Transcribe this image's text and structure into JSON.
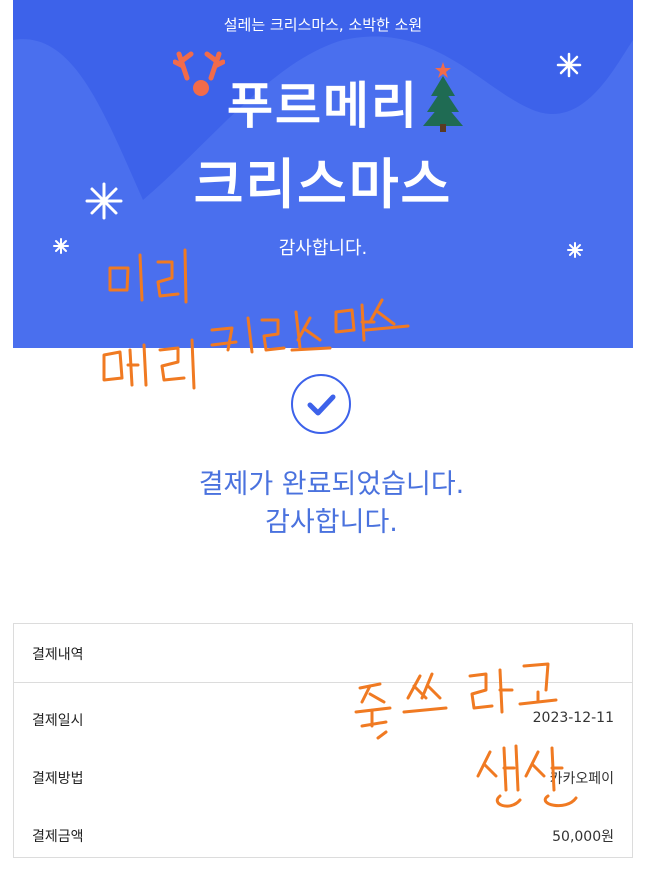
{
  "banner": {
    "tagline": "설레는 크리스마스, 소박한 소원",
    "title_line1": "푸르메리",
    "title_line2": "크리스마스",
    "thanks": "감사합니다."
  },
  "result": {
    "message_line1": "결제가 완료되었습니다.",
    "message_line2": "감사합니다."
  },
  "payment": {
    "header": "결제내역",
    "rows": [
      {
        "label": "결제일시",
        "value": "2023-12-11"
      },
      {
        "label": "결제방법",
        "value": "카카오페이"
      },
      {
        "label": "결제금액",
        "value": "50,000원"
      }
    ]
  },
  "colors": {
    "brand": "#3d62ea",
    "message": "#4a72de",
    "annotation": "#f07a22"
  },
  "annotations": [
    "미리",
    "메리 크리스마스",
    "좋은 쓰려고",
    "생성"
  ]
}
